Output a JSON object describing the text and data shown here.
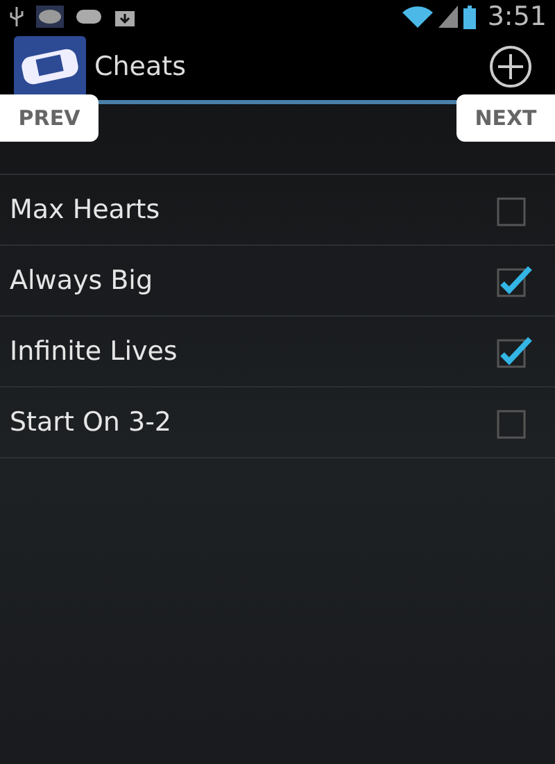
{
  "status_bar": {
    "time": "3:51"
  },
  "action_bar": {
    "title": "Cheats"
  },
  "pager": {
    "prev": "PREV",
    "next": "NEXT"
  },
  "cheats": [
    {
      "name": "Max Hearts",
      "checked": false
    },
    {
      "name": "Always Big",
      "checked": true
    },
    {
      "name": "Infinite Lives",
      "checked": true
    },
    {
      "name": "Start On 3-2",
      "checked": false
    }
  ]
}
